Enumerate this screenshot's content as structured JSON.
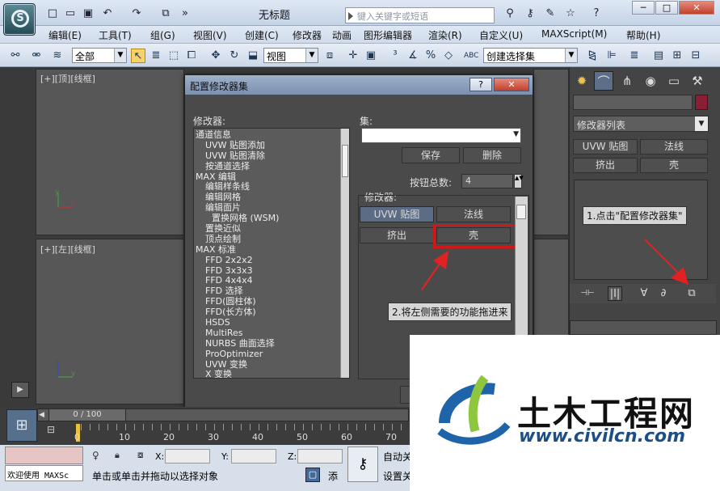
{
  "window": {
    "title": "无标题",
    "search_placeholder": "键入关键字或短语",
    "min": "─",
    "max": "□",
    "close": "✕"
  },
  "quick_access": [
    "□",
    "▭",
    "▣",
    "↶",
    "↷",
    "⧉",
    "»"
  ],
  "menu": [
    "编辑(E)",
    "工具(T)",
    "组(G)",
    "视图(V)",
    "创建(C)",
    "修改器",
    "动画",
    "图形编辑器",
    "渲染(R)",
    "自定义(U)",
    "MAXScript(M)",
    "帮助(H)"
  ],
  "toolbar": {
    "filter_value": "全部",
    "refcoord_value": "视图",
    "selection_set_value": "创建选择集",
    "selection_label": "ABC"
  },
  "viewports": {
    "top_label": "[+][顶][线框]",
    "left_label": "[+][左][线框]",
    "axis_x": "x",
    "axis_y": "y",
    "axis_z": "z"
  },
  "command_panel": {
    "modifier_list": "修改器列表",
    "buttons": [
      "UVW 贴图",
      "法线",
      "挤出",
      "壳"
    ],
    "stack_tools": [
      "⊣⊢",
      "|I|",
      "∀",
      "∂",
      "⧉"
    ]
  },
  "dialog": {
    "title": "配置修改器集",
    "help": "?",
    "close": "✕",
    "modifiers_label": "修改器:",
    "sets_label": "集:",
    "save": "保存",
    "delete": "删除",
    "button_count_label": "按钮总数:",
    "button_count": "4",
    "modifiers_group": "修改器:",
    "slots": [
      "UVW 贴图",
      "法线",
      "挤出",
      "壳"
    ],
    "list": [
      "通道信息",
      "UVW 贴图添加",
      "UVW 贴图清除",
      "按通道选择",
      "MAX 编辑",
      "编辑样条线",
      "编辑网格",
      "编辑面片",
      "置换网格 (WSM)",
      "置换近似",
      "顶点绘制",
      "MAX 标准",
      "FFD 2x2x2",
      "FFD 3x3x3",
      "FFD 4x4x4",
      "FFD 选择",
      "FFD(圆柱体)",
      "FFD(长方体)",
      "HSDS",
      "MultiRes",
      "NURBS 曲面选择",
      "ProOptimizer",
      "UVW 变换",
      "X 变换"
    ]
  },
  "annotations": {
    "step1": "1.点击\"配置修改器集\"",
    "step2": "2.将左侧需要的功能拖进来"
  },
  "timeline": {
    "frame_display": "0 / 100",
    "ticks": [
      "0",
      "10",
      "20",
      "30",
      "40",
      "50",
      "60",
      "70"
    ]
  },
  "status": {
    "welcome": "欢迎使用 MAXSc",
    "prompt": "单击或单击并拖动以选择对象",
    "x_label": "X:",
    "y_label": "Y:",
    "z_label": "Z:",
    "auto_key": "自动关",
    "set_key": "设置关",
    "add": "添"
  },
  "watermark": {
    "name": "土木工程网",
    "url": "www.civilcn.com"
  }
}
